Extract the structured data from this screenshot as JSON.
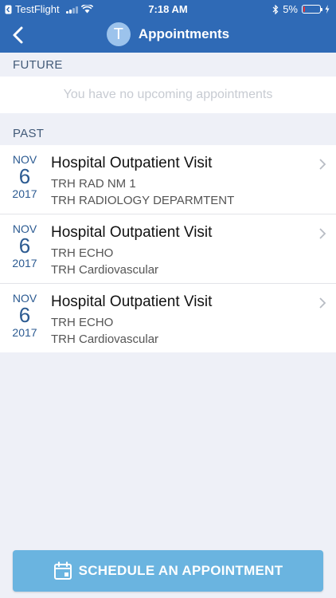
{
  "status_bar": {
    "back_app": "TestFlight",
    "time": "7:18 AM",
    "battery": "5%"
  },
  "nav": {
    "avatar_letter": "T",
    "title": "Appointments"
  },
  "future": {
    "header": "FUTURE",
    "empty_text": "You have no upcoming appointments"
  },
  "past": {
    "header": "PAST",
    "items": [
      {
        "month": "NOV",
        "day": "6",
        "year": "2017",
        "title": "Hospital Outpatient Visit",
        "line1": "TRH RAD NM 1",
        "line2": "TRH RADIOLOGY DEPARMTENT"
      },
      {
        "month": "NOV",
        "day": "6",
        "year": "2017",
        "title": "Hospital Outpatient Visit",
        "line1": "TRH ECHO",
        "line2": "TRH Cardiovascular"
      },
      {
        "month": "NOV",
        "day": "6",
        "year": "2017",
        "title": "Hospital Outpatient Visit",
        "line1": "TRH ECHO",
        "line2": "TRH Cardiovascular"
      }
    ]
  },
  "schedule_button": {
    "label": "SCHEDULE AN APPOINTMENT"
  },
  "colors": {
    "header_bg": "#2f6ab6",
    "page_bg": "#eef0f7",
    "accent_date": "#2b5a91",
    "button_bg": "#6ab4e0"
  },
  "icons": [
    "back-chevron-icon",
    "wifi-icon",
    "bluetooth-icon",
    "battery-icon",
    "chevron-right-icon",
    "calendar-icon"
  ]
}
